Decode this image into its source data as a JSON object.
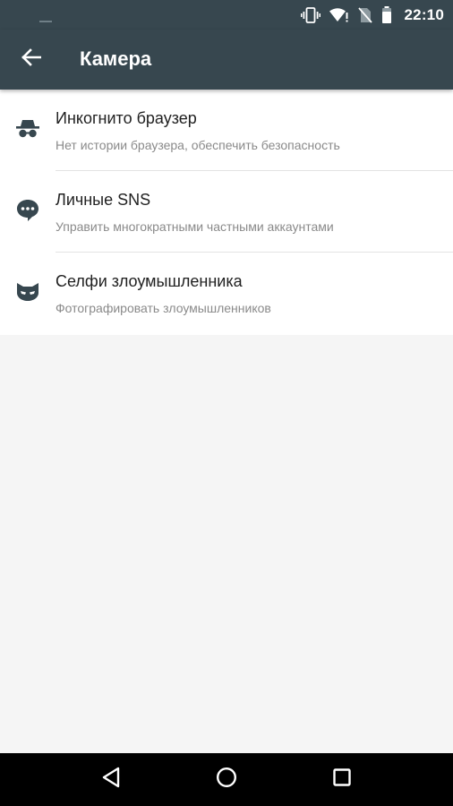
{
  "status_bar": {
    "time": "22:10",
    "icons": [
      "vibrate-icon",
      "wifi-icon",
      "no-sim-icon",
      "battery-icon"
    ]
  },
  "app_bar": {
    "title": "Камера",
    "back_icon": "arrow-back-icon"
  },
  "list": {
    "items": [
      {
        "icon": "incognito-icon",
        "title": "Инкогнито браузер",
        "subtitle": "Нет истории браузера, обеспечить безопасность"
      },
      {
        "icon": "chat-bubble-icon",
        "title": "Личные SNS",
        "subtitle": "Управить многократными частными аккаунтами"
      },
      {
        "icon": "mask-icon",
        "title": "Селфи злоумышленника",
        "subtitle": "Фотографировать злоумышленников"
      }
    ]
  },
  "nav_bar": {
    "buttons": [
      "back-triangle-icon",
      "home-circle-icon",
      "recents-square-icon"
    ]
  },
  "colors": {
    "primary": "#37474f",
    "icon": "#37474f",
    "background": "#f5f5f5"
  }
}
